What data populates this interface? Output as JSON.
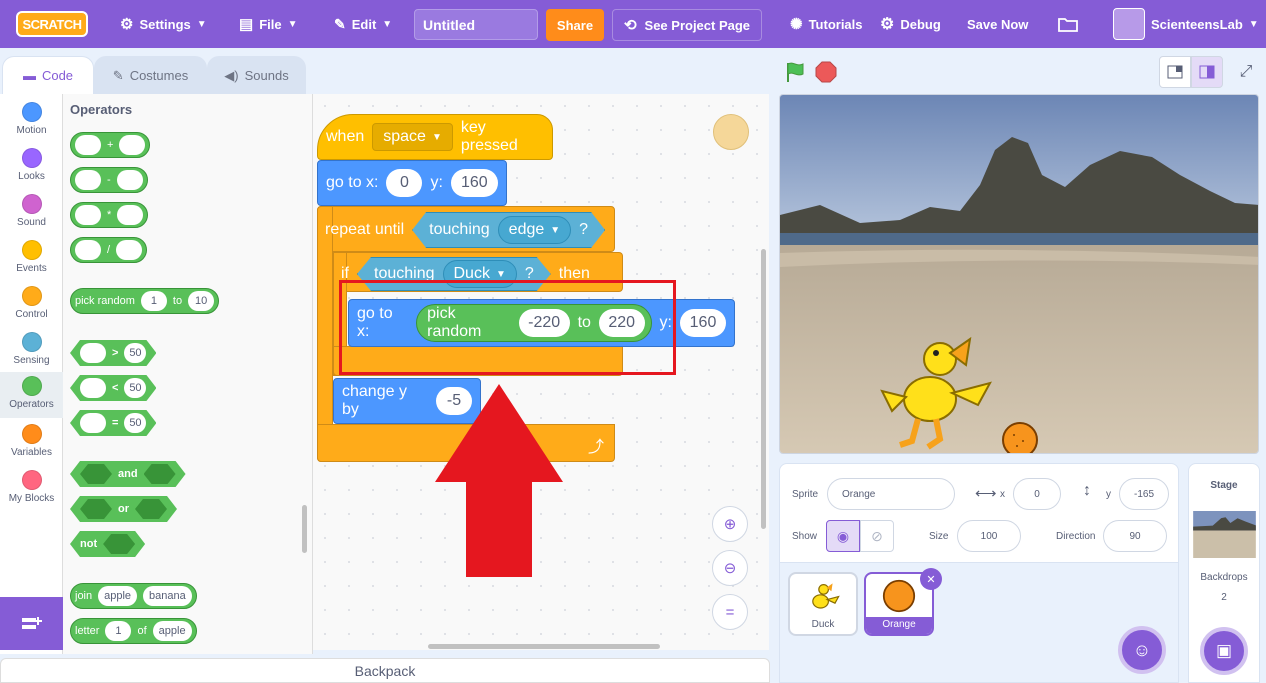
{
  "menubar": {
    "logo": "SCRATCH",
    "settings": "Settings",
    "file": "File",
    "edit": "Edit",
    "project_title": "Untitled",
    "share": "Share",
    "see_project_page": "See Project Page",
    "tutorials": "Tutorials",
    "debug": "Debug",
    "save_now": "Save Now",
    "username": "ScienteensLab"
  },
  "tabs": {
    "code": "Code",
    "costumes": "Costumes",
    "sounds": "Sounds"
  },
  "categories": [
    {
      "label": "Motion",
      "color": "#4c97ff"
    },
    {
      "label": "Looks",
      "color": "#9966ff"
    },
    {
      "label": "Sound",
      "color": "#cf63cf"
    },
    {
      "label": "Events",
      "color": "#ffbf00"
    },
    {
      "label": "Control",
      "color": "#ffab19"
    },
    {
      "label": "Sensing",
      "color": "#5cb1d6"
    },
    {
      "label": "Operators",
      "color": "#59c059"
    },
    {
      "label": "Variables",
      "color": "#ff8c1a"
    },
    {
      "label": "My Blocks",
      "color": "#ff6680"
    }
  ],
  "palette": {
    "title": "Operators",
    "add_op": "+",
    "sub_op": "-",
    "mul_op": "*",
    "div_op": "/",
    "pick_random": "pick random",
    "pr_from": "1",
    "pr_to_word": "to",
    "pr_to": "10",
    "gt_op": ">",
    "lt_op": "<",
    "eq_op": "=",
    "cmp_value": "50",
    "and": "and",
    "or": "or",
    "not": "not",
    "join": "join",
    "join_a": "apple",
    "join_b": "banana",
    "letter": "letter",
    "letter_n": "1",
    "letter_of": "of",
    "letter_word": "apple"
  },
  "script": {
    "when": "when",
    "key": "space",
    "key_pressed": "key pressed",
    "goto1_label": "go to x:",
    "goto1_x": "0",
    "goto1_y_label": "y:",
    "goto1_y": "160",
    "repeat_until": "repeat until",
    "touching": "touching",
    "touching_target": "edge",
    "q": "?",
    "if": "if",
    "if_touching": "touching",
    "if_target": "Duck",
    "then": "then",
    "goto2_label": "go to x:",
    "pick_random": "pick random",
    "pr_from": "-220",
    "pr_to_word": "to",
    "pr_to": "220",
    "goto2_y_label": "y:",
    "goto2_y": "160",
    "change_y": "change y by",
    "change_y_value": "-5"
  },
  "sprite_info": {
    "sprite_label": "Sprite",
    "sprite_name": "Orange",
    "x_label": "x",
    "x_value": "0",
    "y_label": "y",
    "y_value": "-165",
    "show_label": "Show",
    "size_label": "Size",
    "size_value": "100",
    "direction_label": "Direction",
    "direction_value": "90"
  },
  "sprites": [
    {
      "name": "Duck",
      "selected": false
    },
    {
      "name": "Orange",
      "selected": true
    }
  ],
  "stage_panel": {
    "title": "Stage",
    "backdrops_label": "Backdrops",
    "backdrops_count": "2"
  },
  "backpack": "Backpack",
  "colors": {
    "accent": "#855cd6",
    "highlight_box": "#e5171f",
    "arrow": "#e5171f"
  }
}
